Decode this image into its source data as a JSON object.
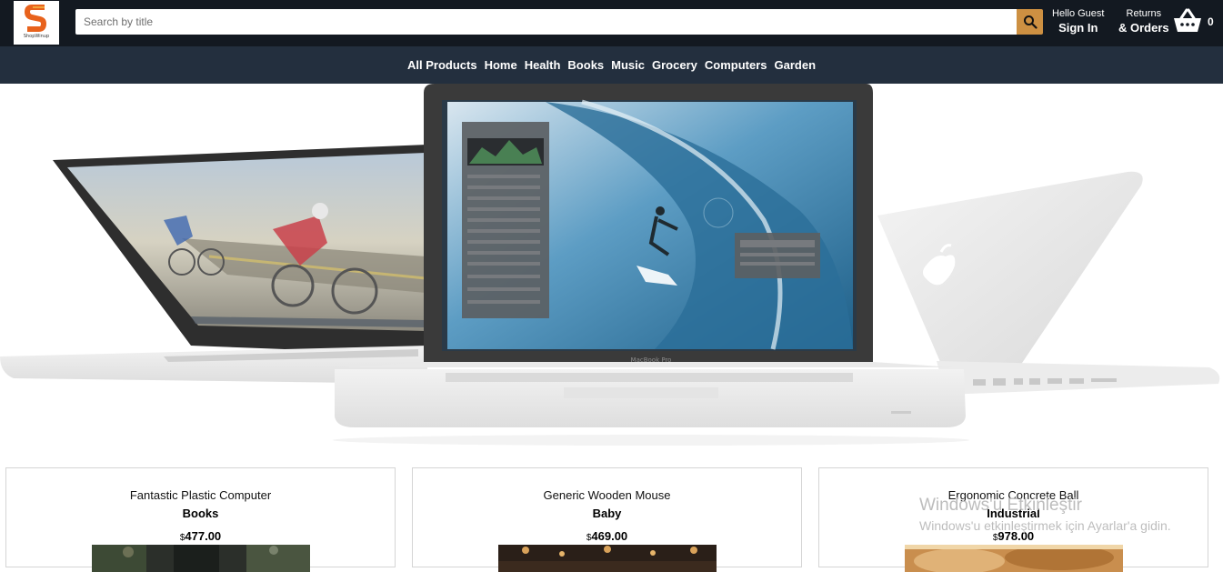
{
  "header": {
    "logo_text": "ShopWinup",
    "search_placeholder": "Search by title",
    "greeting": "Hello Guest",
    "sign_in": "Sign In",
    "returns_label": "Returns",
    "orders_label": "& Orders",
    "cart_count": "0",
    "icons": {
      "search": "search-icon",
      "cart": "basket-icon"
    },
    "colors": {
      "topbar": "#131921",
      "search_button": "#cd9042"
    }
  },
  "nav": {
    "items": [
      "All Products",
      "Home",
      "Health",
      "Books",
      "Music",
      "Grocery",
      "Computers",
      "Garden"
    ],
    "background": "#232f3e"
  },
  "hero": {
    "screen_label": "MacBook Pro"
  },
  "products": [
    {
      "name": "Fantastic Plastic Computer",
      "category": "Books",
      "currency": "$",
      "price": "477.00"
    },
    {
      "name": "Generic Wooden Mouse",
      "category": "Baby",
      "currency": "$",
      "price": "469.00"
    },
    {
      "name": "Ergonomic Concrete Ball",
      "category": "Industrial",
      "currency": "$",
      "price": "978.00"
    }
  ],
  "os_watermark": {
    "line1": "Windows'u Etkinleştir",
    "line2": "Windows'u etkinleştirmek için Ayarlar'a gidin."
  }
}
